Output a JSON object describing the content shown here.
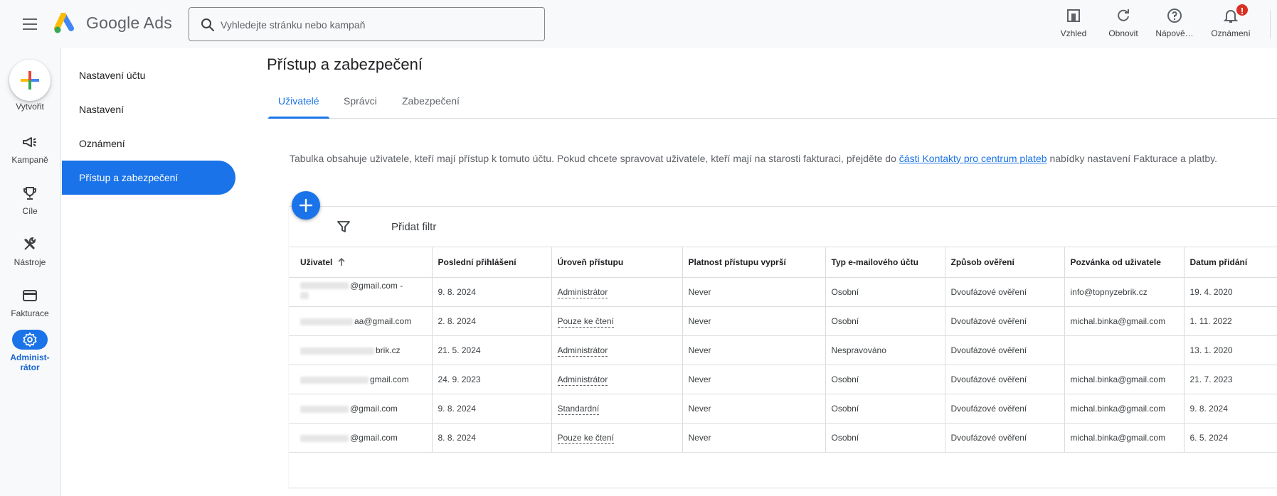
{
  "header": {
    "brand": "Google Ads",
    "search_placeholder": "Vyhledejte stránku nebo kampaň",
    "actions": [
      {
        "label": "Vzhled",
        "icon": "appearance-icon"
      },
      {
        "label": "Obnovit",
        "icon": "refresh-icon"
      },
      {
        "label": "Nápově…",
        "icon": "help-icon"
      },
      {
        "label": "Oznámení",
        "icon": "bell-icon",
        "badge": "!"
      }
    ]
  },
  "rail": {
    "create_label": "Vytvořit",
    "items": [
      {
        "label": "Kampaně",
        "icon": "megaphone-icon"
      },
      {
        "label": "Cíle",
        "icon": "trophy-icon"
      },
      {
        "label": "Nástroje",
        "icon": "tools-icon"
      },
      {
        "label": "Fakturace",
        "icon": "credit-card-icon"
      },
      {
        "label": "Administ-\nrátor",
        "icon": "gear-icon",
        "active": true
      }
    ]
  },
  "subnav": {
    "items": [
      {
        "label": "Nastavení účtu"
      },
      {
        "label": "Nastavení"
      },
      {
        "label": "Oznámení"
      },
      {
        "label": "Přístup a zabezpečení",
        "active": true
      }
    ]
  },
  "main": {
    "title": "Přístup a zabezpečení",
    "tabs": [
      {
        "label": "Uživatelé",
        "active": true
      },
      {
        "label": "Správci"
      },
      {
        "label": "Zabezpečení"
      }
    ],
    "description_before": "Tabulka obsahuje uživatele, kteří mají přístup k tomuto účtu. Pokud chcete spravovat uživatele, kteří mají na starosti fakturaci, přejděte do ",
    "description_link": "části Kontakty pro centrum plateb",
    "description_after": " nabídky nastavení Fakturace a platby.",
    "filter_label": "Přidat filtr"
  },
  "table": {
    "columns": [
      "Uživatel",
      "Poslední přihlášení",
      "Úroveň přístupu",
      "Platnost přístupu vyprší",
      "Typ e-mailového účtu",
      "Způsob ověření",
      "Pozvánka od uživatele",
      "Datum přidání"
    ],
    "rows": [
      {
        "user": "@gmail.com -",
        "user_line2": "Ty",
        "last_login": "9. 8. 2024",
        "access": "Administrátor",
        "expires": "Never",
        "email_type": "Osobní",
        "verification": "Dvoufázové ověření",
        "invited_by": "info@topnyzebrik.cz",
        "added": "19. 4. 2020"
      },
      {
        "user": "aa@gmail.com",
        "last_login": "2. 8. 2024",
        "access": "Pouze ke čtení",
        "expires": "Never",
        "email_type": "Osobní",
        "verification": "Dvoufázové ověření",
        "invited_by": "michal.binka@gmail.com",
        "added": "1. 11. 2022"
      },
      {
        "user": "brik.cz",
        "last_login": "21. 5. 2024",
        "access": "Administrátor",
        "expires": "Never",
        "email_type": "Nespravováno",
        "verification": "Dvoufázové ověření",
        "invited_by": "",
        "added": "13. 1. 2020"
      },
      {
        "user": "gmail.com",
        "last_login": "24. 9. 2023",
        "access": "Administrátor",
        "expires": "Never",
        "email_type": "Osobní",
        "verification": "Dvoufázové ověření",
        "invited_by": "michal.binka@gmail.com",
        "added": "21. 7. 2023"
      },
      {
        "user": "@gmail.com",
        "last_login": "9. 8. 2024",
        "access": "Standardní",
        "expires": "Never",
        "email_type": "Osobní",
        "verification": "Dvoufázové ověření",
        "invited_by": "michal.binka@gmail.com",
        "added": "9. 8. 2024"
      },
      {
        "user": "@gmail.com",
        "last_login": "8. 8. 2024",
        "access": "Pouze ke čtení",
        "expires": "Never",
        "email_type": "Osobní",
        "verification": "Dvoufázové ověření",
        "invited_by": "michal.binka@gmail.com",
        "added": "6. 5. 2024"
      }
    ]
  },
  "colors": {
    "accent": "#1a73e8",
    "badge": "#d93025"
  }
}
